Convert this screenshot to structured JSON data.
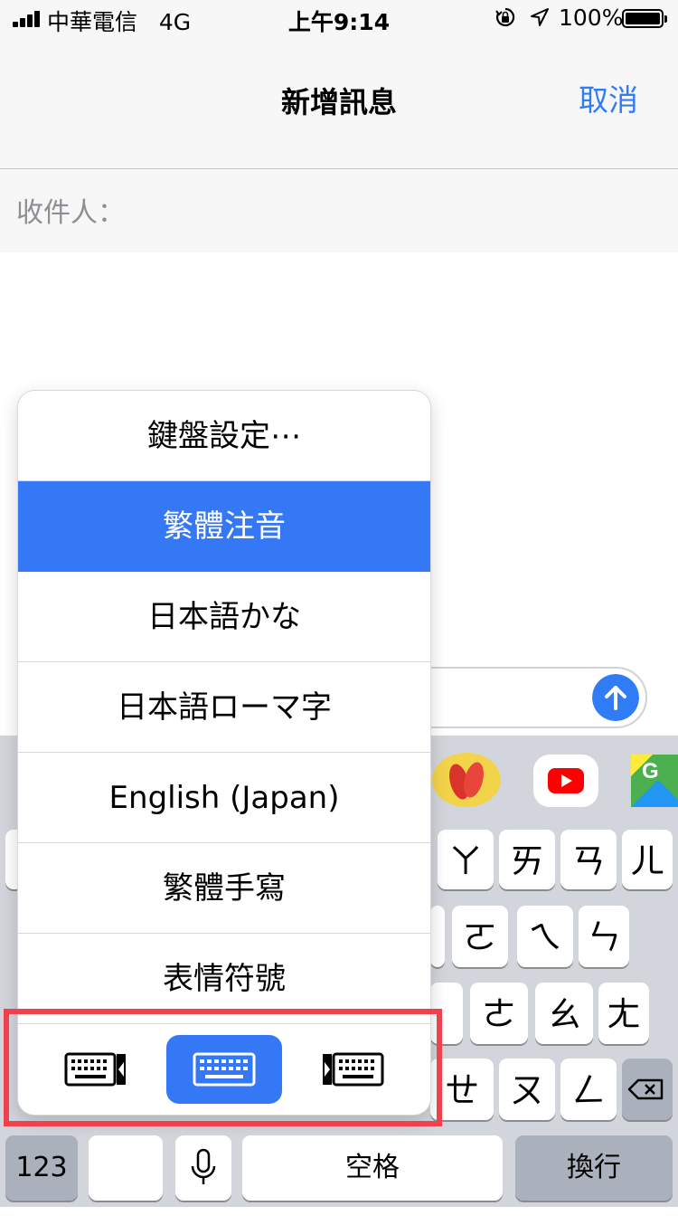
{
  "status_bar": {
    "carrier": "中華電信",
    "network": "4G",
    "time": "上午9:14",
    "battery": "100%",
    "icons": [
      "signal-bars-icon",
      "rotation-lock-icon",
      "location-arrow-icon",
      "battery-icon"
    ]
  },
  "nav": {
    "title": "新增訊息",
    "cancel_label": "取消"
  },
  "recipient": {
    "label": "收件人："
  },
  "keyboard_menu": {
    "items": [
      {
        "label": "鍵盤設定⋯"
      },
      {
        "label": "繁體注音",
        "selected": true
      },
      {
        "label": "日本語かな"
      },
      {
        "label": "日本語ローマ字"
      },
      {
        "label": "English (Japan)"
      },
      {
        "label": "繁體手寫"
      },
      {
        "label": "表情符號"
      }
    ],
    "modes": [
      "keyboard-left-icon",
      "keyboard-full-icon",
      "keyboard-right-icon"
    ],
    "active_mode": "keyboard-full-icon"
  },
  "app_strip": {
    "apps": [
      "flip-flops-sticker-icon",
      "youtube-icon",
      "google-maps-icon"
    ]
  },
  "keys": {
    "row1": [
      "ㄚ",
      "ㄞ",
      "ㄢ",
      "ㄦ"
    ],
    "row2": [
      "ㄛ",
      "ㄟ",
      "ㄣ"
    ],
    "row3": [
      "ㄜ",
      "ㄠ",
      "ㄤ"
    ],
    "row4": [
      "ㄝ",
      "ㄡ",
      "ㄥ"
    ],
    "numbers_label": "123",
    "space_label": "空格",
    "return_label": "換行"
  },
  "colors": {
    "accent": "#2f7cf6",
    "selection": "#3478f6",
    "highlight_border": "#f0414e",
    "keyboard_bg": "#d2d5db"
  }
}
